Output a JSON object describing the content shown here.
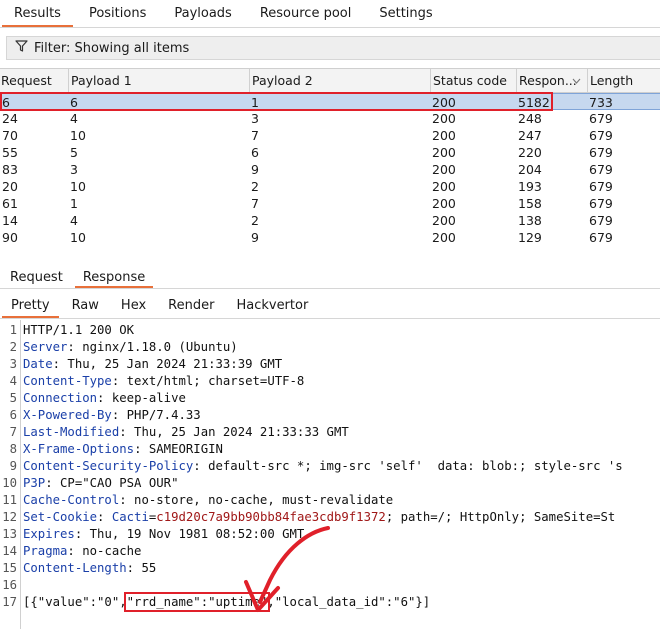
{
  "top_tabs": [
    "Results",
    "Positions",
    "Payloads",
    "Resource pool",
    "Settings"
  ],
  "filter": {
    "text": "Filter: Showing all items"
  },
  "table": {
    "headers": [
      "Request",
      "Payload 1",
      "Payload 2",
      "Status code",
      "Respon...",
      "Length"
    ],
    "rows": [
      [
        "6",
        "6",
        "1",
        "200",
        "5182",
        "733"
      ],
      [
        "24",
        "4",
        "3",
        "200",
        "248",
        "679"
      ],
      [
        "70",
        "10",
        "7",
        "200",
        "247",
        "679"
      ],
      [
        "55",
        "5",
        "6",
        "200",
        "220",
        "679"
      ],
      [
        "83",
        "3",
        "9",
        "200",
        "204",
        "679"
      ],
      [
        "20",
        "10",
        "2",
        "200",
        "193",
        "679"
      ],
      [
        "61",
        "1",
        "7",
        "200",
        "158",
        "679"
      ],
      [
        "14",
        "4",
        "2",
        "200",
        "138",
        "679"
      ],
      [
        "90",
        "10",
        "9",
        "200",
        "129",
        "679"
      ]
    ]
  },
  "mid_tabs": [
    "Request",
    "Response"
  ],
  "sub_tabs": [
    "Pretty",
    "Raw",
    "Hex",
    "Render",
    "Hackvertor"
  ],
  "response_lines": [
    {
      "n": "1",
      "key": "",
      "val": "HTTP/1.1 200 OK"
    },
    {
      "n": "2",
      "key": "Server",
      "val": " nginx/1.18.0 (Ubuntu)"
    },
    {
      "n": "3",
      "key": "Date",
      "val": " Thu, 25 Jan 2024 21:33:39 GMT"
    },
    {
      "n": "4",
      "key": "Content-Type",
      "val": " text/html; charset=UTF-8"
    },
    {
      "n": "5",
      "key": "Connection",
      "val": " keep-alive"
    },
    {
      "n": "6",
      "key": "X-Powered-By",
      "val": " PHP/7.4.33"
    },
    {
      "n": "7",
      "key": "Last-Modified",
      "val": " Thu, 25 Jan 2024 21:33:33 GMT"
    },
    {
      "n": "8",
      "key": "X-Frame-Options",
      "val": " SAMEORIGIN"
    },
    {
      "n": "9",
      "key": "Content-Security-Policy",
      "val": " default-src *; img-src 'self'  data: blob:; style-src 's"
    },
    {
      "n": "10",
      "key": "P3P",
      "val": " CP=\"CAO PSA OUR\""
    },
    {
      "n": "11",
      "key": "Cache-Control",
      "val": " no-store, no-cache, must-revalidate"
    },
    {
      "n": "12",
      "key": "Set-Cookie",
      "val": " Cacti=c19d20c7a9bb90bb84fae3cdb9f1372; path=/; HttpOnly; SameSite=St"
    },
    {
      "n": "13",
      "key": "Expires",
      "val": " Thu, 19 Nov 1981 08:52:00 GMT"
    },
    {
      "n": "14",
      "key": "Pragma",
      "val": " no-cache"
    },
    {
      "n": "15",
      "key": "Content-Length",
      "val": " 55"
    },
    {
      "n": "16",
      "key": "",
      "val": ""
    },
    {
      "n": "17",
      "key": "",
      "val": "[{\"value\":\"0\",\"rrd_name\":\"uptime\",\"local_data_id\":\"6\"}]"
    }
  ],
  "cookie": {
    "name": "Cacti",
    "value": "c19d20c7a9bb90bb84fae3cdb9f1372",
    "rest": "; path=/; HttpOnly; SameSite=St"
  },
  "body_parts": {
    "p1": "[{\"value\":\"0\",",
    "p2": "\"rrd_name\":\"uptime\"",
    "p3": ",\"local_data_id\":\"6\"}]"
  },
  "colors": {
    "accent": "#e8703a",
    "selected_row": "#c6d8ef",
    "highlight": "#e0202a",
    "header_key": "#1a3fa8",
    "cookie_value": "#a01818"
  }
}
